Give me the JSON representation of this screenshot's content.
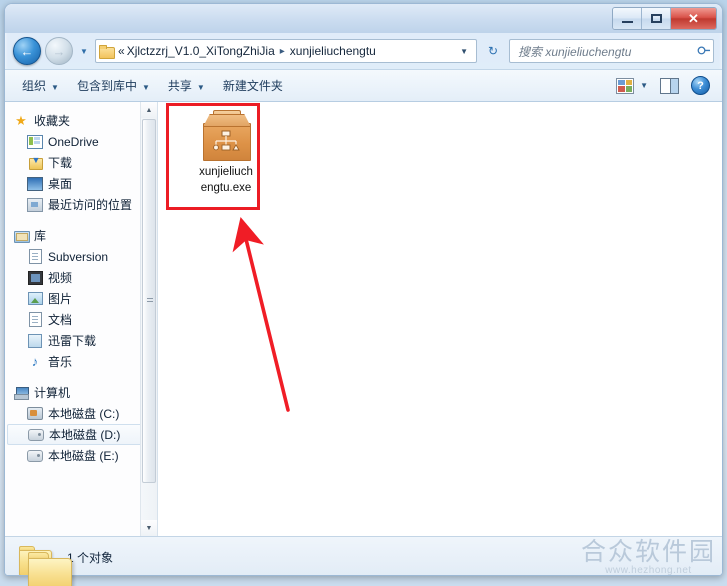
{
  "window": {
    "controls": {
      "minimize": "—",
      "maximize": "□",
      "close": "✕"
    }
  },
  "addressbar": {
    "back_icon": "←",
    "forward_icon": "→",
    "history_caret": "▼",
    "folder_icon": "folder-icon",
    "crumb_prefix": "«",
    "crumb_parent": "Xjlctzzrj_V1.0_XiTongZhiJia",
    "crumb_sep": "▸",
    "crumb_current": "xunjieliuchengtu",
    "dropdown_caret": "▼",
    "refresh_icon": "↻",
    "search_placeholder": "搜索 xunjieliuchengtu",
    "search_icon": "⌕"
  },
  "commandbar": {
    "items": [
      {
        "label": "组织",
        "has_caret": true
      },
      {
        "label": "包含到库中",
        "has_caret": true
      },
      {
        "label": "共享",
        "has_caret": true
      },
      {
        "label": "新建文件夹",
        "has_caret": false
      }
    ],
    "caret": "▼",
    "view_caret": "▼",
    "help_label": "?"
  },
  "sidebar": {
    "groups": [
      {
        "header": {
          "label": "收藏夹",
          "icon": "star-icon"
        },
        "items": [
          {
            "label": "OneDrive",
            "icon": "onedrive-icon"
          },
          {
            "label": "下载",
            "icon": "downloads-icon"
          },
          {
            "label": "桌面",
            "icon": "desktop-icon"
          },
          {
            "label": "最近访问的位置",
            "icon": "recent-places-icon"
          }
        ]
      },
      {
        "header": {
          "label": "库",
          "icon": "library-icon"
        },
        "items": [
          {
            "label": "Subversion",
            "icon": "document-icon"
          },
          {
            "label": "视频",
            "icon": "video-icon"
          },
          {
            "label": "图片",
            "icon": "picture-icon"
          },
          {
            "label": "文档",
            "icon": "document-icon"
          },
          {
            "label": "迅雷下载",
            "icon": "xunlei-icon"
          },
          {
            "label": "音乐",
            "icon": "music-icon"
          }
        ]
      },
      {
        "header": {
          "label": "计算机",
          "icon": "computer-icon"
        },
        "items": [
          {
            "label": "本地磁盘 (C:)",
            "icon": "disk-system-icon",
            "selected": false
          },
          {
            "label": "本地磁盘 (D:)",
            "icon": "disk-icon",
            "selected": true
          },
          {
            "label": "本地磁盘 (E:)",
            "icon": "disk-icon",
            "selected": false
          }
        ]
      }
    ],
    "scroll_up": "▲",
    "scroll_down": "▼"
  },
  "content": {
    "file": {
      "name_line1": "xunjieliuch",
      "name_line2": "engtu.exe",
      "icon": "setup-box-icon"
    },
    "annotation": {
      "highlight_color": "#ec1c24",
      "arrow_color": "#f01d26"
    }
  },
  "statusbar": {
    "folder_icon": "folder-icon",
    "text": "1 个对象"
  },
  "watermark": {
    "title": "合众软件园",
    "url": "www.hezhong.net"
  }
}
